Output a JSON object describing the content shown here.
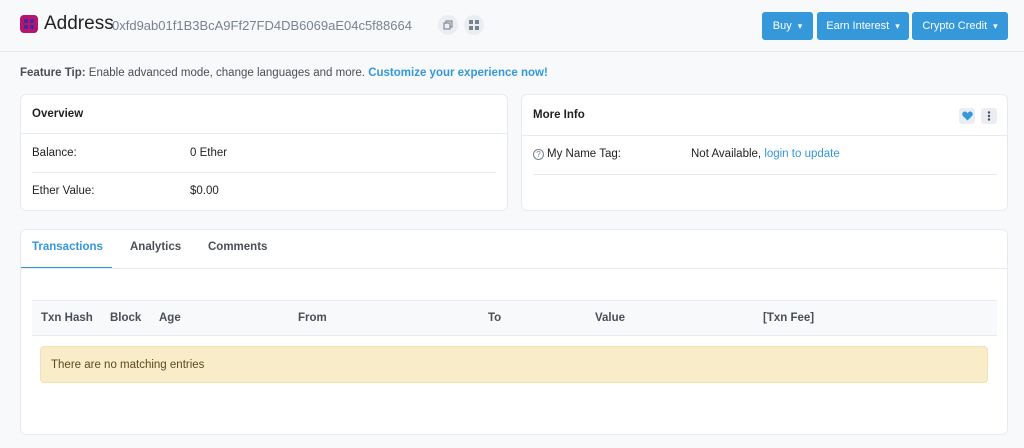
{
  "header": {
    "title": "Address",
    "address": "0xfd9ab01f1B3BcA9Ff27FD4DB6069aE04c5f88664",
    "buttons": {
      "buy": "Buy",
      "earn": "Earn Interest",
      "credit": "Crypto Credit"
    }
  },
  "tip": {
    "label": "Feature Tip:",
    "text": " Enable advanced mode, change languages and more. ",
    "link": "Customize your experience now!"
  },
  "overview": {
    "title": "Overview",
    "balance_label": "Balance:",
    "balance_value": "0 Ether",
    "value_label": "Ether Value:",
    "value_value": "$0.00"
  },
  "more_info": {
    "title": "More Info",
    "name_tag_label": "My Name Tag:",
    "name_tag_value": "Not Available, ",
    "name_tag_link": "login to update"
  },
  "tabs": [
    "Transactions",
    "Analytics",
    "Comments"
  ],
  "table": {
    "columns": [
      "Txn Hash",
      "Block",
      "Age",
      "From",
      "To",
      "Value",
      "[Txn Fee]"
    ],
    "empty_message": "There are no matching entries"
  },
  "colors": {
    "accent": "#3498db",
    "avatar": "#b5156b",
    "warning_bg": "#f8ecc9"
  },
  "icons": {
    "copy": "copy-icon",
    "qr": "qr-code-icon",
    "caret": "chevron-down-icon",
    "heart": "heart-icon",
    "more": "more-vertical-icon",
    "help": "help-circle-icon"
  }
}
